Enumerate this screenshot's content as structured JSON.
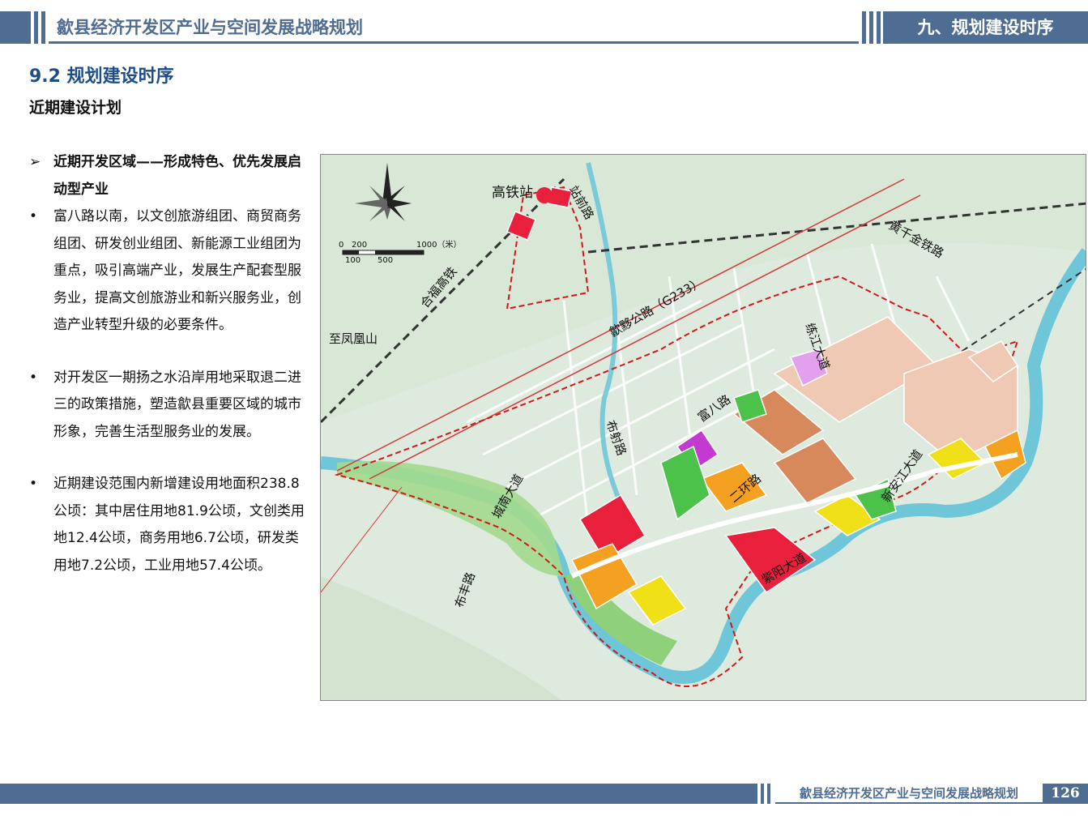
{
  "header": {
    "doc_title": "歙县经济开发区产业与空间发展战略规划",
    "section": "九、规划建设时序"
  },
  "section_title": "9.2 规划建设时序",
  "subtitle": "近期建设计划",
  "content": {
    "lead_marker": "➢",
    "bullet_marker": "•",
    "lead": "近期开发区域——形成特色、优先发展启动型产业",
    "bullets": [
      "富八路以南，以文创旅游组团、商贸商务组团、研发创业组团、新能源工业组团为重点，吸引高端产业，发展生产配套型服务业，提高文创旅游业和新兴服务业，创造产业转型升级的必要条件。",
      "对开发区一期扬之水沿岸用地采取退二进三的政策措施，塑造歙县重要区域的城市形象，完善生活型服务业的发展。",
      "近期建设范围内新增建设用地面积238.8公顷：其中居住用地81.9公顷，文创类用地12.4公顷，商务用地6.7公顷，研发类用地7.2公顷，工业用地57.4公顷。"
    ]
  },
  "map": {
    "labels": {
      "station": "高铁站",
      "station_road": "站前路",
      "railway_hefu": "合福高铁",
      "railway_huangqian": "黄千金铁路",
      "g233": "歙黟公路（G233）",
      "fenghuang": "至凤凰山",
      "lianjiang": "练江大道",
      "fuba": "富八路",
      "bushe": "布射路",
      "erhuan": "二环路",
      "xinanjiang": "新安江大道",
      "chengnan": "城南大道",
      "bufeng": "布丰路",
      "ziyang": "紫阳大道"
    },
    "scale": {
      "top": [
        "0",
        "200",
        "1000（米）"
      ],
      "bottom": [
        "100",
        "500"
      ]
    },
    "colors": {
      "river": "#6fc6d8",
      "green": "#4cc24a",
      "residential": "#f0c9b4",
      "commercial": "#e8203c",
      "culture": "#c23ad0",
      "industrial": "#d8895c",
      "rd": "#f0e018",
      "mixed": "#f4a020",
      "boundary": "#d01818"
    }
  },
  "footer": {
    "doc_title": "歙县经济开发区产业与空间发展战略规划",
    "page": "126"
  }
}
